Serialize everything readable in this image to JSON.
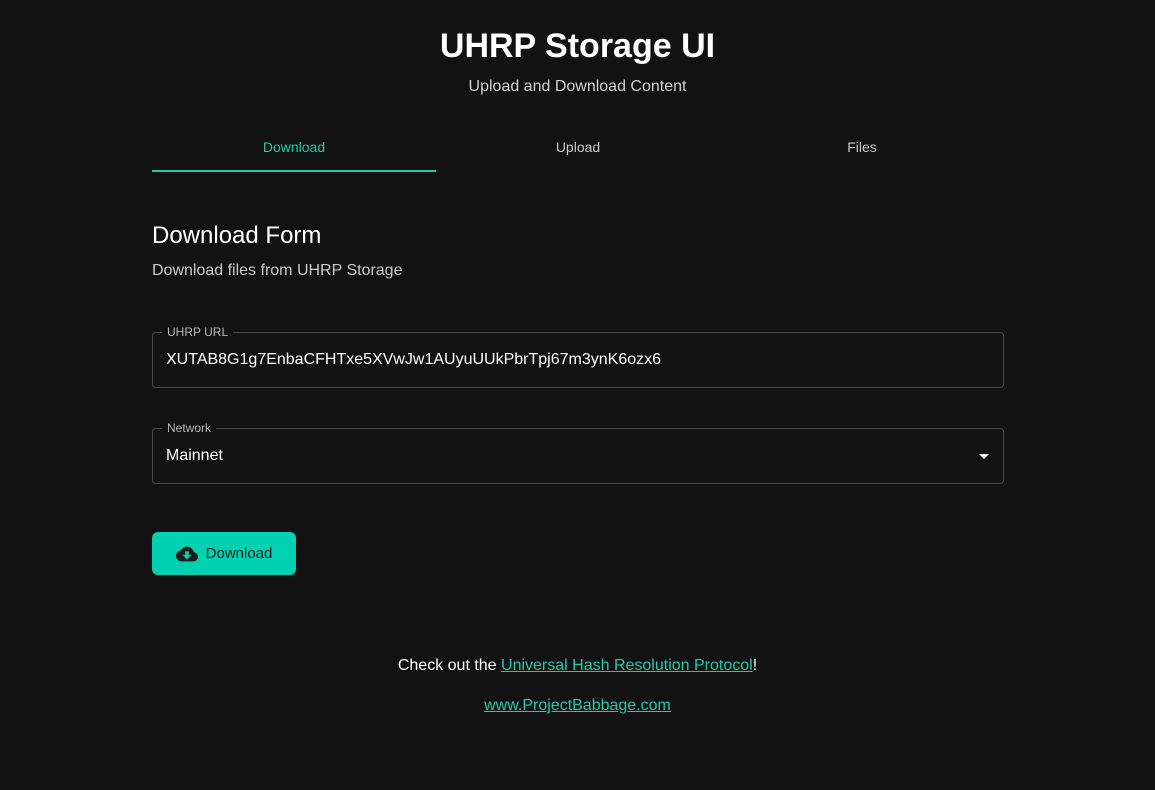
{
  "header": {
    "title": "UHRP Storage UI",
    "subtitle": "Upload and Download Content"
  },
  "tabs": [
    {
      "label": "Download",
      "active": true
    },
    {
      "label": "Upload",
      "active": false
    },
    {
      "label": "Files",
      "active": false
    }
  ],
  "form": {
    "title": "Download Form",
    "subtitle": "Download files from UHRP Storage",
    "url_field": {
      "label": "UHRP URL",
      "value": "XUTAB8G1g7EnbaCFHTxe5XVwJw1AUyuUUkPbrTpj67m3ynK6ozx6"
    },
    "network_field": {
      "label": "Network",
      "value": "Mainnet"
    },
    "download_button": {
      "label": "Download",
      "icon": "cloud-download-icon"
    }
  },
  "footer": {
    "prefix": "Check out the ",
    "link_text": "Universal Hash Resolution Protocol",
    "suffix": "!",
    "site_link": "www.ProjectBabbage.com"
  },
  "colors": {
    "background": "#121212",
    "accent": "#26c9a6",
    "button": "#00d1b2"
  }
}
